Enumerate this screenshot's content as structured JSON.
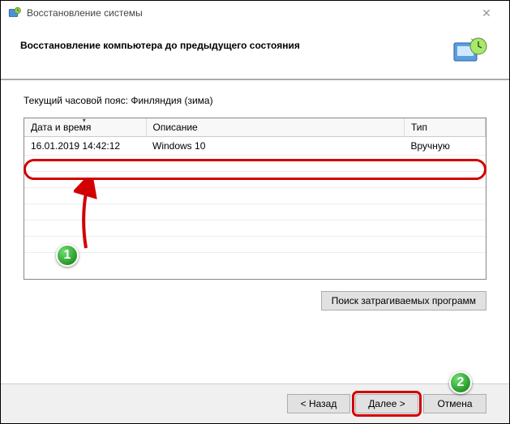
{
  "window": {
    "title": "Восстановление системы",
    "heading": "Восстановление компьютера до предыдущего состояния"
  },
  "content": {
    "timezone_label": "Текущий часовой пояс: Финляндия (зима)",
    "columns": {
      "datetime": "Дата и время",
      "description": "Описание",
      "type": "Тип"
    },
    "rows": [
      {
        "datetime": "16.01.2019 14:42:12",
        "description": "Windows 10",
        "type": "Вручную"
      }
    ],
    "affected_programs_btn": "Поиск затрагиваемых программ"
  },
  "footer": {
    "back": "< Назад",
    "next": "Далее >",
    "cancel": "Отмена"
  },
  "annotations": {
    "badge1": "1",
    "badge2": "2"
  }
}
